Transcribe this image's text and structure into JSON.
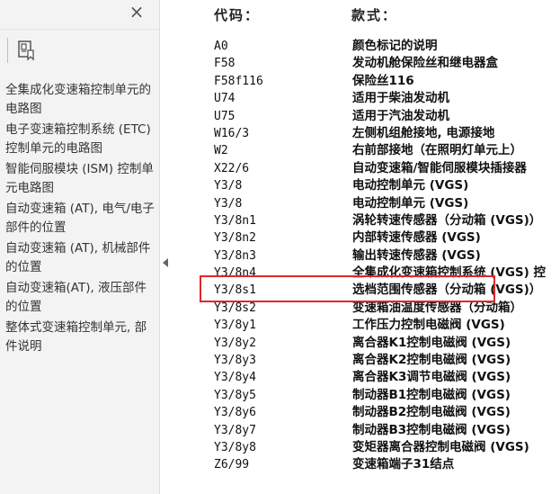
{
  "sidebar": {
    "close_label": "×",
    "nav_items": [
      {
        "label": "全集成化变速箱控制单元的电路图"
      },
      {
        "label": "电子变速箱控制系统 (ETC) 控制单元的电路图"
      },
      {
        "label": "智能伺服模块 (ISM) 控制单元电路图"
      },
      {
        "label": "自动变速箱 (AT), 电气/电子部件的位置"
      },
      {
        "label": "自动变速箱 (AT), 机械部件的位置"
      },
      {
        "label": "自动变速箱(AT), 液压部件的位置"
      },
      {
        "label": "整体式变速箱控制单元, 部件说明"
      }
    ]
  },
  "table": {
    "header_code": "代码：",
    "header_desc": "款式：",
    "rows": [
      {
        "code": "A0",
        "desc": "颜色标记的说明"
      },
      {
        "code": "F58",
        "desc": "发动机舱保险丝和继电器盒"
      },
      {
        "code": "F58f116",
        "desc": "保险丝116"
      },
      {
        "code": "U74",
        "desc": "适用于柴油发动机"
      },
      {
        "code": "U75",
        "desc": "适用于汽油发动机"
      },
      {
        "code": "W16/3",
        "desc": "左侧机组舱接地, 电源接地"
      },
      {
        "code": "W2",
        "desc": "右前部接地（在照明灯单元上）"
      },
      {
        "code": "X22/6",
        "desc": "自动变速箱/智能伺服模块插接器"
      },
      {
        "code": "Y3/8",
        "desc": "电动控制单元 (VGS)"
      },
      {
        "code": "Y3/8",
        "desc": "电动控制单元 (VGS)"
      },
      {
        "code": "Y3/8n1",
        "desc": "涡轮转速传感器（分动箱 (VGS)）"
      },
      {
        "code": "Y3/8n2",
        "desc": "内部转速传感器 (VGS)"
      },
      {
        "code": "Y3/8n3",
        "desc": "输出转速传感器 (VGS)"
      },
      {
        "code": "Y3/8n4",
        "desc": "全集成化变速箱控制系统 (VGS) 控"
      },
      {
        "code": "Y3/8s1",
        "desc": "选档范围传感器（分动箱 (VGS)）"
      },
      {
        "code": "Y3/8s2",
        "desc": "变速箱油温度传感器（分动箱）"
      },
      {
        "code": "Y3/8y1",
        "desc": "工作压力控制电磁阀 (VGS)"
      },
      {
        "code": "Y3/8y2",
        "desc": "离合器K1控制电磁阀 (VGS)"
      },
      {
        "code": "Y3/8y3",
        "desc": "离合器K2控制电磁阀 (VGS)"
      },
      {
        "code": "Y3/8y4",
        "desc": "离合器K3调节电磁阀 (VGS)"
      },
      {
        "code": "Y3/8y5",
        "desc": "制动器B1控制电磁阀 (VGS)"
      },
      {
        "code": "Y3/8y6",
        "desc": "制动器B2控制电磁阀 (VGS)"
      },
      {
        "code": "Y3/8y7",
        "desc": "制动器B3控制电磁阀 (VGS)"
      },
      {
        "code": "Y3/8y8",
        "desc": "变矩器离合器控制电磁阀 (VGS)"
      },
      {
        "code": "Z6/99",
        "desc": "变速箱端子31结点"
      }
    ]
  },
  "highlight": {
    "color": "#e0262b",
    "row_code": "Y3/8s1"
  }
}
